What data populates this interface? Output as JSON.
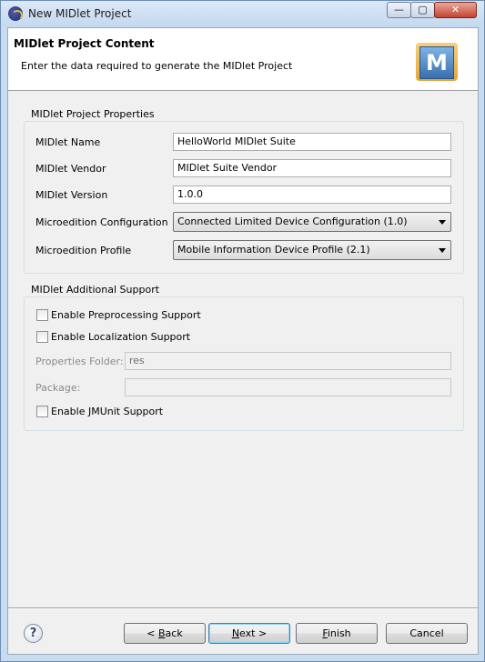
{
  "window": {
    "title": "New MIDlet Project",
    "controls": {
      "minimize": "—",
      "maximize": "▢",
      "close": "✕"
    }
  },
  "header": {
    "title": "MIDlet Project Content",
    "description": "Enter the data required to generate the MIDlet Project",
    "image_letter": "M"
  },
  "properties": {
    "group_label": "MIDlet Project Properties",
    "name_label": "MIDlet Name",
    "name_value": "HelloWorld MIDlet Suite",
    "vendor_label": "MIDlet Vendor",
    "vendor_value": "MIDlet Suite Vendor",
    "version_label": "MIDlet Version",
    "version_value": "1.0.0",
    "config_label": "Microedition Configuration",
    "config_value": "Connected Limited Device Configuration (1.0)",
    "profile_label": "Microedition Profile",
    "profile_value": "Mobile Information Device Profile (2.1)"
  },
  "support": {
    "group_label": "MIDlet Additional Support",
    "preprocessing_label": "Enable Preprocessing Support",
    "preprocessing_checked": false,
    "localization_label": "Enable Localization Support",
    "localization_checked": false,
    "properties_folder_label": "Properties Folder:",
    "properties_folder_value": "res",
    "package_label": "Package:",
    "package_value": "",
    "jmunit_label": "Enable JMUnit Support",
    "jmunit_checked": false
  },
  "buttons": {
    "help": "?",
    "back_prefix": "< ",
    "back_mnemonic": "B",
    "back_rest": "ack",
    "next_mnemonic": "N",
    "next_rest": "ext >",
    "finish_mnemonic": "F",
    "finish_rest": "inish",
    "cancel": "Cancel"
  }
}
